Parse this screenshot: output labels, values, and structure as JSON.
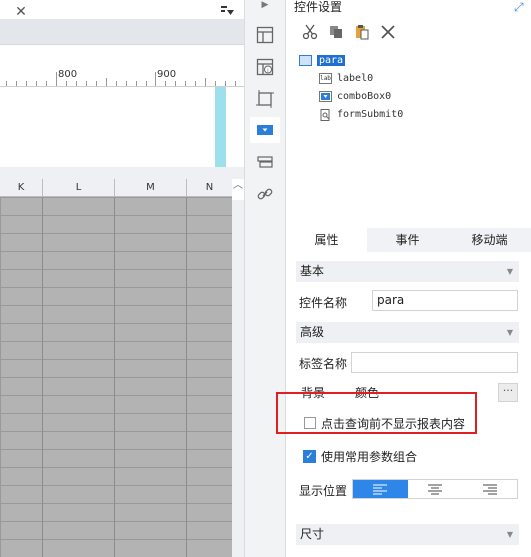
{
  "ruler": {
    "labels": [
      "800",
      "900"
    ]
  },
  "columns": [
    "K",
    "L",
    "M",
    "N"
  ],
  "panel": {
    "title": "控件设置",
    "toolbar": [
      "cut-icon",
      "copy-icon",
      "paste-icon",
      "delete-icon"
    ],
    "tree": {
      "root": "para",
      "children": [
        {
          "label": "label0",
          "icon": "label-icon"
        },
        {
          "label": "comboBox0",
          "icon": "combobox-icon"
        },
        {
          "label": "formSubmit0",
          "icon": "form-submit-icon"
        }
      ]
    },
    "tabs": [
      "属性",
      "事件",
      "移动端"
    ],
    "sections": {
      "basic": "基本",
      "advanced": "高级",
      "size": "尺寸"
    },
    "fields": {
      "widget_name_label": "控件名称",
      "widget_name_value": "para",
      "tag_name_label": "标签名称",
      "tag_name_value": "",
      "background_label": "背景",
      "background_value": "颜色",
      "hide_before_query_label": "点击查询前不显示报表内容",
      "hide_before_query_checked": false,
      "use_param_combo_label": "使用常用参数组合",
      "use_param_combo_checked": true,
      "display_position_label": "显示位置",
      "alignment_selected": "left"
    },
    "colors": {
      "accent": "#2e86e8",
      "highlight_box": "#e02020"
    }
  }
}
